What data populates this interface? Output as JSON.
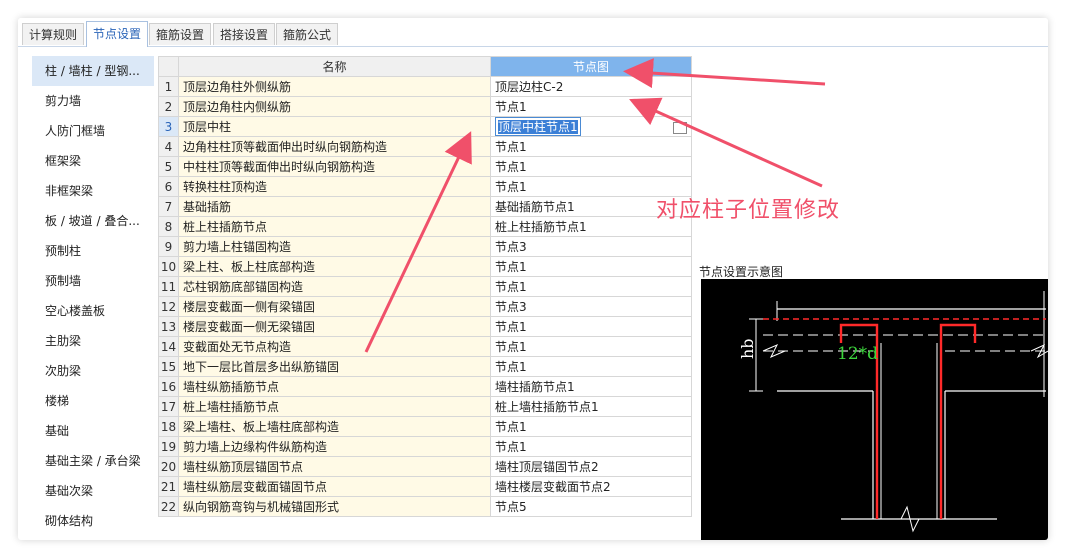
{
  "tabs": [
    "计算规则",
    "节点设置",
    "箍筋设置",
    "搭接设置",
    "箍筋公式"
  ],
  "active_tab": 1,
  "sidebar": {
    "items": [
      "柱 / 墙柱 / 型钢...",
      "剪力墙",
      "人防门框墙",
      "框架梁",
      "非框架梁",
      "板 / 坡道 / 叠合...",
      "预制柱",
      "预制墙",
      "空心楼盖板",
      "主肋梁",
      "次肋梁",
      "楼梯",
      "基础",
      "基础主梁 / 承台梁",
      "基础次梁",
      "砌体结构"
    ],
    "active": 0
  },
  "table": {
    "headers": {
      "name": "名称",
      "node": "节点图"
    },
    "rows": [
      {
        "idx": "1",
        "name": "顶层边角柱外侧纵筋",
        "node": "顶层边柱C-2"
      },
      {
        "idx": "2",
        "name": "顶层边角柱内侧纵筋",
        "node": "节点1"
      },
      {
        "idx": "3",
        "name": "顶层中柱",
        "node": "顶层中柱节点1"
      },
      {
        "idx": "4",
        "name": "边角柱柱顶等截面伸出时纵向钢筋构造",
        "node": "节点1"
      },
      {
        "idx": "5",
        "name": "中柱柱顶等截面伸出时纵向钢筋构造",
        "node": "节点1"
      },
      {
        "idx": "6",
        "name": "转换柱柱顶构造",
        "node": "节点1"
      },
      {
        "idx": "7",
        "name": "基础插筋",
        "node": "基础插筋节点1"
      },
      {
        "idx": "8",
        "name": "桩上柱插筋节点",
        "node": "桩上柱插筋节点1"
      },
      {
        "idx": "9",
        "name": "剪力墙上柱锚固构造",
        "node": "节点3"
      },
      {
        "idx": "10",
        "name": "梁上柱、板上柱底部构造",
        "node": "节点1"
      },
      {
        "idx": "11",
        "name": "芯柱钢筋底部锚固构造",
        "node": "节点1"
      },
      {
        "idx": "12",
        "name": "楼层变截面一侧有梁锚固",
        "node": "节点3"
      },
      {
        "idx": "13",
        "name": "楼层变截面一侧无梁锚固",
        "node": "节点1"
      },
      {
        "idx": "14",
        "name": "变截面处无节点构造",
        "node": "节点1"
      },
      {
        "idx": "15",
        "name": "地下一层比首层多出纵筋锚固",
        "node": "节点1"
      },
      {
        "idx": "16",
        "name": "墙柱纵筋插筋节点",
        "node": "墙柱插筋节点1"
      },
      {
        "idx": "17",
        "name": "桩上墙柱插筋节点",
        "node": "桩上墙柱插筋节点1"
      },
      {
        "idx": "18",
        "name": "梁上墙柱、板上墙柱底部构造",
        "node": "节点1"
      },
      {
        "idx": "19",
        "name": "剪力墙上边缘构件纵筋构造",
        "node": "节点1"
      },
      {
        "idx": "20",
        "name": "墙柱纵筋顶层锚固节点",
        "node": "墙柱顶层锚固节点2"
      },
      {
        "idx": "21",
        "name": "墙柱纵筋层变截面锚固节点",
        "node": "墙柱楼层变截面节点2"
      },
      {
        "idx": "22",
        "name": "纵向钢筋弯钩与机械锚固形式",
        "node": "节点5"
      }
    ],
    "selected_row": 2
  },
  "preview": {
    "label": "节点设置示意图",
    "dim_hb": "hb",
    "dim_anchor": "12*d"
  },
  "annotation": "对应柱子位置修改",
  "colors": {
    "accent": "#2a64b8",
    "header_node": "#7fb4ec",
    "annotation": "#f0506a",
    "rebar": "#ff2a2a",
    "dim_green": "#3cd23c"
  }
}
